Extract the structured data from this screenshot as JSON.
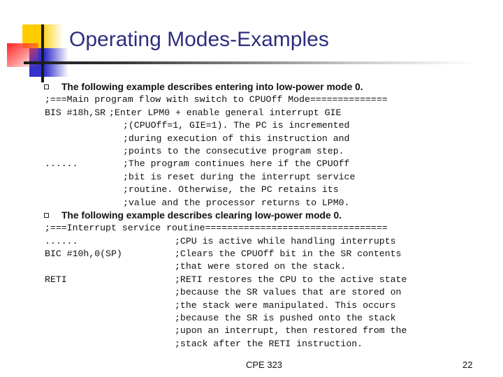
{
  "slide": {
    "title": "Operating Modes-Examples",
    "bullets": [
      {
        "icon": "square-bullet-icon",
        "text": "The following example describes entering into low-power mode 0."
      },
      {
        "icon": "square-bullet-icon",
        "text": "The following example describes clearing low-power mode 0."
      }
    ],
    "code_block_1": {
      "header": ";===Main program flow with switch to CPUOff Mode==============",
      "lines": [
        {
          "code": "BIS #18h,SR",
          "comment": ";Enter LPM0 + enable general interrupt GIE"
        },
        {
          "code": "",
          "comment": ";(CPUOff=1, GIE=1). The PC is incremented"
        },
        {
          "code": "",
          "comment": ";during execution of this instruction and"
        },
        {
          "code": "",
          "comment": ";points to the consecutive program step."
        },
        {
          "code": "......",
          "comment": ";The program continues here if the CPUOff"
        },
        {
          "code": "",
          "comment": ";bit is reset during the interrupt service"
        },
        {
          "code": "",
          "comment": ";routine. Otherwise, the PC retains its"
        },
        {
          "code": "",
          "comment": ";value and the processor returns to LPM0."
        }
      ]
    },
    "code_block_2": {
      "header": ";===Interrupt service routine=================================",
      "lines": [
        {
          "code": "......",
          "comment": ";CPU is active while handling interrupts"
        },
        {
          "code": "BIC #10h,0(SP)",
          "comment": ";Clears the CPUOff bit in the SR contents"
        },
        {
          "code": "",
          "comment": ";that were stored on the stack."
        },
        {
          "code": "RETI",
          "comment": ";RETI restores the CPU to the active state"
        },
        {
          "code": "",
          "comment": ";because the SR values that are stored on"
        },
        {
          "code": "",
          "comment": ";the stack were manipulated. This occurs"
        },
        {
          "code": "",
          "comment": ";because the SR is pushed onto the stack"
        },
        {
          "code": "",
          "comment": ";upon an interrupt, then restored from the"
        },
        {
          "code": "",
          "comment": ";stack after the RETI instruction."
        }
      ]
    },
    "footer": {
      "course": "CPE 323",
      "page_number": "22"
    },
    "colors": {
      "title": "#2e2e80",
      "deco_yellow": "#ffcc00",
      "deco_blue": "#3333cc",
      "deco_red": "#ff2222"
    }
  }
}
